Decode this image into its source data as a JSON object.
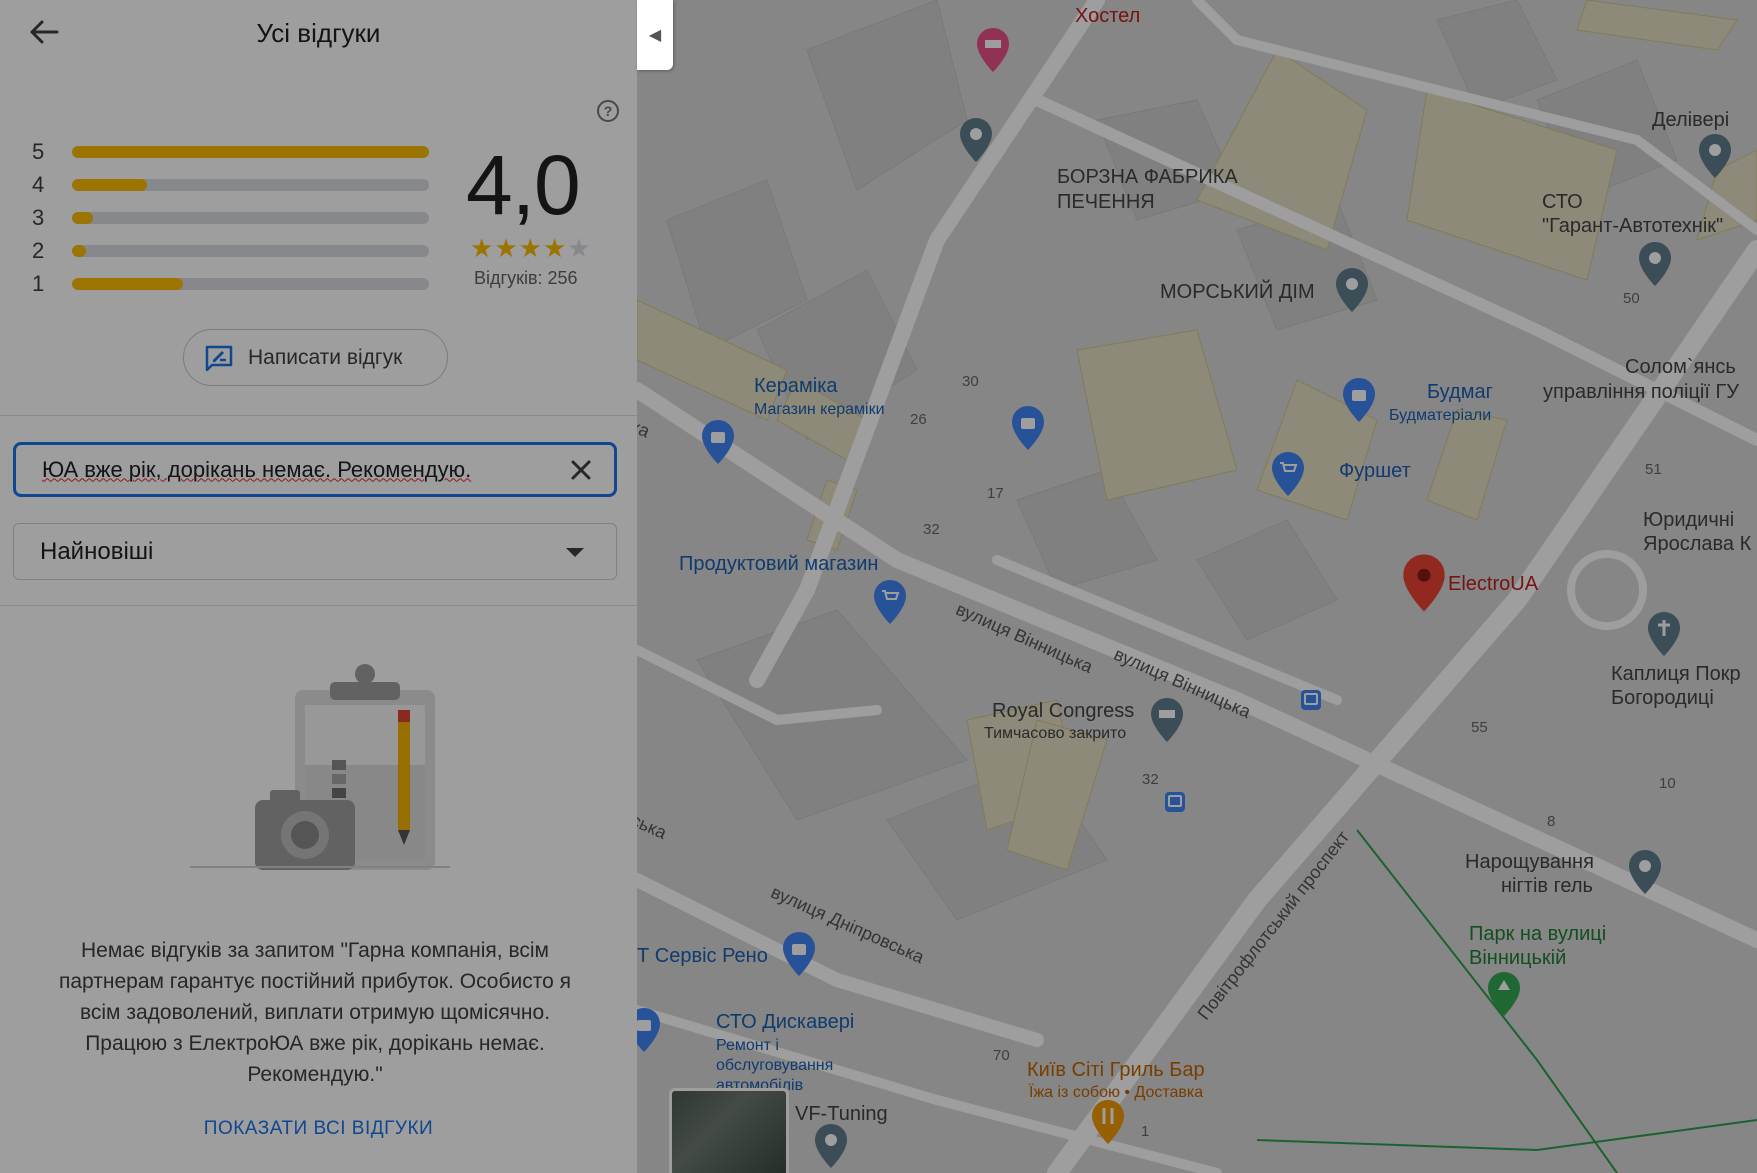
{
  "panel": {
    "title": "Усі відгуки",
    "rating": "4,0",
    "stars": {
      "filled": 4,
      "total": 5
    },
    "review_count": "Відгуків: 256",
    "distribution": [
      {
        "label": "5",
        "fraction": 1.0
      },
      {
        "label": "4",
        "fraction": 0.21
      },
      {
        "label": "3",
        "fraction": 0.06
      },
      {
        "label": "2",
        "fraction": 0.04
      },
      {
        "label": "1",
        "fraction": 0.31
      }
    ],
    "write_review_label": "Написати відгук",
    "search_value": "ЮА вже рік, дорікань немає. Рекомендую.",
    "sort_value": "Найновіші",
    "empty_message": "Немає відгуків за запитом \"Гарна компанія, всім партнерам гарантує постійний прибуток. Особисто я всім задоволений, виплати отримую щомісячно. Працюю з ЕлектроЮА вже рік, дорікань немає. Рекомендую.\"",
    "show_all_label": "ПОКАЗАТИ ВСІ ВІДГУКИ",
    "accent_color": "#1a73e8",
    "star_color": "#fbbc04"
  },
  "map": {
    "labels": {
      "hostel": "Хостел",
      "borzna": "БОРЗНА ФАБРИКА",
      "borzna2": "ПЕЧЕННЯ",
      "deliveri": "Делівері",
      "sto_garant": "СТО",
      "sto_garant2": "\"Гарант-Автотехнік\"",
      "morskyi": "МОРСЬКИЙ ДІМ",
      "keramika": "Кераміка",
      "keramika_sub": "Магазин кераміки",
      "budmag": "Будмаг",
      "budmag_sub": "Будматеріали",
      "solom": "Солом`янсь",
      "police": "управління поліції ГУ",
      "furshet": "Фуршет",
      "produkt": "Продуктовий магазин",
      "electroua": "ElectroUA",
      "yur": "Юридичні",
      "yur2": "Ярослава К",
      "chapel": "Каплиця Покр",
      "chapel2": "Богородиці",
      "royal": "Royal Congress",
      "royal_sub": "Тимчасово закрито",
      "street_vinn1": "вулиця Вінницька",
      "street_vinn2": "вулиця Вінницька",
      "street_dnipro": "вулиця Дніпровська",
      "street_povitro": "Повітрофлотський проспект",
      "naroshch": "Нарощування",
      "naroshch2": "нігтів гель",
      "park": "Парк на вулиці",
      "park2": "Вінницькій",
      "servis_reno": "Т Сервіс Рено",
      "sto_disk": "СТО Дискавері",
      "sto_disk_sub1": "Ремонт і",
      "sto_disk_sub2": "обслуговування",
      "sto_disk_sub3": "автомобілів",
      "kyiv_grill": "Київ Сіті Гриль Бар",
      "kyiv_grill_sub": "Їжа із собою • Доставка",
      "vf_tuning": "VF-Tuning",
      "ka": "ка",
      "ska": "ська",
      "n30": "30",
      "n26": "26",
      "n17": "17",
      "n32a": "32",
      "n32b": "32",
      "n50": "50",
      "n51": "51",
      "n55": "55",
      "n10": "10",
      "n8": "8",
      "n70": "70",
      "n1": "1"
    }
  }
}
